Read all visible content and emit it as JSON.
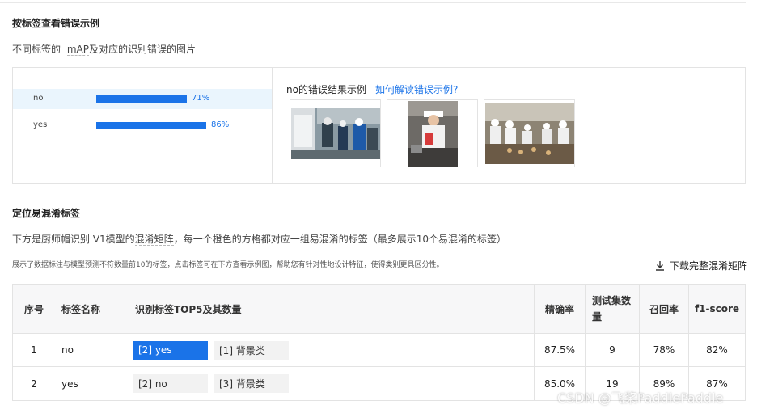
{
  "section1": {
    "title": "按标签查看错误示例",
    "desc_prefix": "不同标签的",
    "desc_term": "mAP",
    "desc_suffix": "及对应的识别错误的图片"
  },
  "bars": [
    {
      "label": "no",
      "value": 0.71,
      "value_text": "71%"
    },
    {
      "label": "yes",
      "value": 0.86,
      "value_text": "86%"
    }
  ],
  "examples": {
    "title": "no的错误结果示例",
    "link": "如何解读错误示例?"
  },
  "section2": {
    "title": "定位易混淆标签",
    "desc_a": "下方是厨师帽识别 V1模型的",
    "desc_term": "混淆矩阵",
    "desc_b": "，每一个橙色的方格都对应一组易混淆的标签（最多展示10个易混淆的标签）",
    "note": "展示了数据标注与模型预测不符数量前10的标签，点击标签可在下方查看示例图，帮助您有针对性地设计特征，使得类别更具区分性。",
    "download": "下载完整混淆矩阵"
  },
  "table": {
    "headers": {
      "idx": "序号",
      "name": "标签名称",
      "top5": "识别标签TOP5及其数量",
      "precision": "精确率",
      "testset": "测试集数量",
      "recall": "召回率",
      "f1": "f1-score"
    },
    "rows": [
      {
        "idx": "1",
        "name": "no",
        "tag_a": "[2] yes",
        "tag_b": "[1] 背景类",
        "precision": "87.5%",
        "testset": "9",
        "recall": "78%",
        "f1": "82%"
      },
      {
        "idx": "2",
        "name": "yes",
        "tag_a": "[2] no",
        "tag_b": "[3] 背景类",
        "precision": "85.0%",
        "testset": "19",
        "recall": "89%",
        "f1": "87%"
      }
    ]
  },
  "watermark": "CSDN @飞桨PaddlePaddle",
  "colors": {
    "accent": "#1a73e8",
    "row_highlight": "#eaf5fd",
    "header_bg": "#f7f7f8"
  }
}
